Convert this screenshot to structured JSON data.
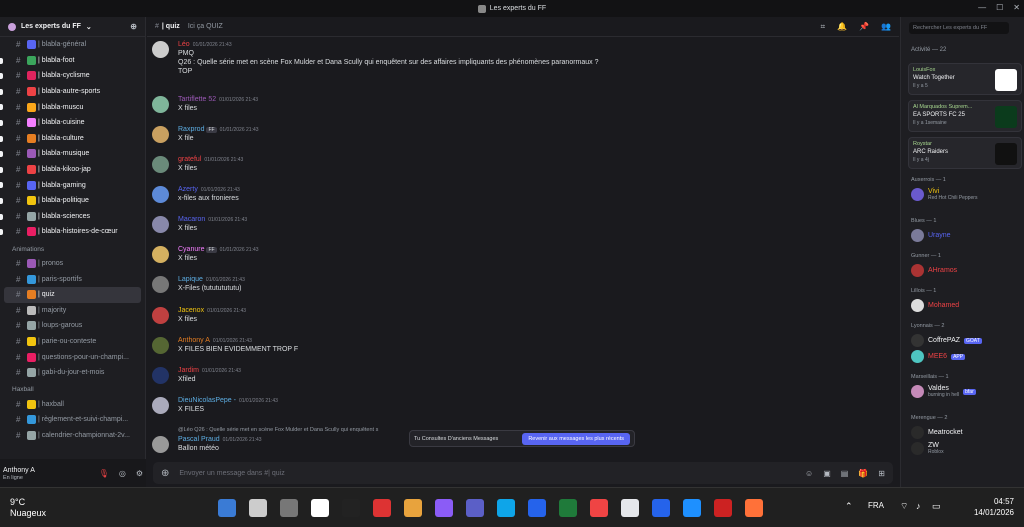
{
  "window": {
    "title": "Les experts du FF"
  },
  "server": {
    "name": "Les experts du FF"
  },
  "channels_top": [
    {
      "label": "| blabla-général",
      "bold": false,
      "color": "#5865f2"
    },
    {
      "label": "| blabla-foot",
      "bold": true,
      "color": "#3ba55c"
    },
    {
      "label": "| blabla-cyclisme",
      "bold": true,
      "color": "#e0245e"
    },
    {
      "label": "| blabla-autre-sports",
      "bold": true,
      "color": "#ed4245"
    },
    {
      "label": "| blabla-muscu",
      "bold": true,
      "color": "#faa61a"
    },
    {
      "label": "| blabla-cuisine",
      "bold": true,
      "color": "#f47fff"
    },
    {
      "label": "| blabla-culture",
      "bold": true,
      "color": "#e67e22"
    },
    {
      "label": "| blabla-musique",
      "bold": true,
      "color": "#9b59b6"
    },
    {
      "label": "| blabla-kikoo-jap",
      "bold": true,
      "color": "#ed4245"
    },
    {
      "label": "| blabla-gaming",
      "bold": true,
      "color": "#5865f2"
    },
    {
      "label": "| blabla-politique",
      "bold": true,
      "color": "#f1c40f"
    },
    {
      "label": "| blabla-sciences",
      "bold": true,
      "color": "#95a5a6"
    },
    {
      "label": "| blabla-histoires-de-cœur",
      "bold": true,
      "color": "#e91e63"
    }
  ],
  "category_animations": "Animations",
  "channels_anim": [
    {
      "label": "| pronos",
      "color": "#9b59b6",
      "active": false
    },
    {
      "label": "| paris-sportifs",
      "color": "#3498db",
      "active": false
    },
    {
      "label": "| quiz",
      "color": "#e67e22",
      "active": true
    },
    {
      "label": "| majority",
      "color": "#bbbbbb",
      "active": false
    },
    {
      "label": "| loups-garous",
      "color": "#95a5a6",
      "active": false
    },
    {
      "label": "| parie-ou-conteste",
      "color": "#f1c40f",
      "active": false
    },
    {
      "label": "| questions-pour-un-champi...",
      "color": "#e91e63",
      "active": false
    },
    {
      "label": "| gabi-du-jour-et-mois",
      "color": "#95a5a6",
      "active": false
    }
  ],
  "category_haxball": "Haxball",
  "channels_hax": [
    {
      "label": "| haxball",
      "color": "#f1c40f"
    },
    {
      "label": "| règlement-et-suivi-champi...",
      "color": "#3498db"
    },
    {
      "label": "| calendrier-championnat-2v...",
      "color": "#95a5a6"
    }
  ],
  "user": {
    "name": "Anthony A",
    "status": "En ligne"
  },
  "channel_header": {
    "name": "| quiz",
    "topic": "Ici ça QUIZ"
  },
  "messages": [
    {
      "author": "Léo",
      "color": "#ed4245",
      "ts": "01/01/2026 21:43",
      "lines": [
        "PMQ",
        "Q26 : Quelle série met en scène Fox Mulder et Dana Scully qui enquêtent sur des affaires impliquants des phénomènes paranormaux ?",
        "TOP"
      ],
      "av": "#ccc"
    },
    {
      "author": "Tartiflette 52",
      "color": "#9b59b6",
      "ts": "01/01/2026 21:43",
      "lines": [
        "X files"
      ],
      "av": "#7fb59a"
    },
    {
      "author": "Raxprod",
      "color": "#5dade2",
      "ts": "01/01/2026 21:43",
      "lines": [
        "X file"
      ],
      "av": "#c9a060",
      "badge": "FF"
    },
    {
      "author": "grateful",
      "color": "#ed4245",
      "ts": "01/01/2026 21:43",
      "lines": [
        "X files"
      ],
      "av": "#6a8a7a"
    },
    {
      "author": "Azerty",
      "color": "#5865f2",
      "ts": "01/01/2026 21:43",
      "lines": [
        "x-files aux fronieres"
      ],
      "av": "#5d8ad8"
    },
    {
      "author": "Macaron",
      "color": "#5865f2",
      "ts": "01/01/2026 21:43",
      "lines": [
        "X files"
      ],
      "av": "#8888aa"
    },
    {
      "author": "Cyanure",
      "color": "#f47fff",
      "ts": "01/01/2026 21:43",
      "lines": [
        "X files"
      ],
      "av": "#d4b060",
      "badge": "FF"
    },
    {
      "author": "Lapique",
      "color": "#5dade2",
      "ts": "01/01/2026 21:43",
      "lines": [
        "X-Files (tutututututu)"
      ],
      "av": "#777"
    },
    {
      "author": "Jacenox",
      "color": "#f1c40f",
      "ts": "01/01/2026 21:43",
      "lines": [
        "X files"
      ],
      "av": "#c04040"
    },
    {
      "author": "Anthony A",
      "color": "#e67e22",
      "ts": "01/01/2026 21:43",
      "lines": [
        "X FILES BIEN EVIDEMMENT TROP F"
      ],
      "av": "#556633"
    },
    {
      "author": "Jardim",
      "color": "#ed4245",
      "ts": "01/01/2026 21:43",
      "lines": [
        "Xfiled"
      ],
      "av": "#223366"
    },
    {
      "author": "DieuNicolasPepe -",
      "color": "#5dade2",
      "ts": "01/01/2026 21:43",
      "lines": [
        "X FILES"
      ],
      "av": "#aab"
    },
    {
      "author": "Pascal Praud",
      "color": "#5dade2",
      "ts": "01/01/2026 21:43",
      "lines": [
        "Ballon météo"
      ],
      "av": "#999",
      "reply": "@Léo Q26 : Quelle série met en scène Fox Mulder et Dana Scully qui enquêtent s"
    }
  ],
  "toast": {
    "text": "Tu Consultes D'anciens Messages",
    "button": "Revenir aux messages les plus récents"
  },
  "input": {
    "placeholder": "Envoyer un message dans #| quiz"
  },
  "search": {
    "placeholder": "Rechercher Les experts du FF"
  },
  "activity": {
    "title": "Activité — 22"
  },
  "cards": [
    {
      "user": "LouisFox",
      "game": "Watch Together",
      "sub": "Il y a 5",
      "img": "#ffffff"
    },
    {
      "user": "Al Marquados Suprem...",
      "game": "EA SPORTS FC 25",
      "sub": "Il y a 1semaine",
      "img": "#0b3b1c"
    },
    {
      "user": "Roystar",
      "game": "ARC Raiders",
      "sub": "Il y a 4j",
      "img": "#111111"
    }
  ],
  "member_groups": [
    {
      "cat": "Auxerrois — 1",
      "members": [
        {
          "name": "Vivi",
          "color": "#f1c40f",
          "sub": "Red Hot Chili Peppers",
          "av": "#6a5acd"
        }
      ]
    },
    {
      "cat": "Blues — 1",
      "members": [
        {
          "name": "Urayne",
          "color": "#5865f2",
          "sub": "",
          "av": "#7a7a99"
        }
      ]
    },
    {
      "cat": "Gunner — 1",
      "members": [
        {
          "name": "AHramos",
          "color": "#ed4245",
          "sub": "",
          "av": "#aa3333"
        }
      ]
    },
    {
      "cat": "Lillois — 1",
      "members": [
        {
          "name": "Mohamed",
          "color": "#ed4245",
          "sub": "",
          "av": "#ddd"
        }
      ]
    },
    {
      "cat": "Lyonnais — 2",
      "members": [
        {
          "name": "CoffrePAZ",
          "color": "#f2f3f5",
          "sub": "",
          "av": "#333",
          "tag": "GOAT"
        },
        {
          "name": "MEE6",
          "color": "#ed4245",
          "sub": "",
          "av": "#4ec5c1",
          "tag": "APP"
        }
      ]
    },
    {
      "cat": "Marseillais — 1",
      "members": [
        {
          "name": "Valdes",
          "color": "#f2f3f5",
          "sub": "burning in hell",
          "av": "#c58ab8",
          "tag": "bfar"
        }
      ]
    },
    {
      "cat": "Merengue — 2",
      "members": [
        {
          "name": "Meatrocket",
          "color": "#f2f3f5",
          "sub": "",
          "av": "#2a2a2a"
        },
        {
          "name": "ZW",
          "color": "#f2f3f5",
          "sub": "Roblox",
          "av": "#2a2a2a"
        }
      ]
    }
  ],
  "taskbar": {
    "temp": "9°C",
    "weather": "Nuageux",
    "lang": "FRA",
    "time": "04:57",
    "date": "14/01/2026"
  }
}
